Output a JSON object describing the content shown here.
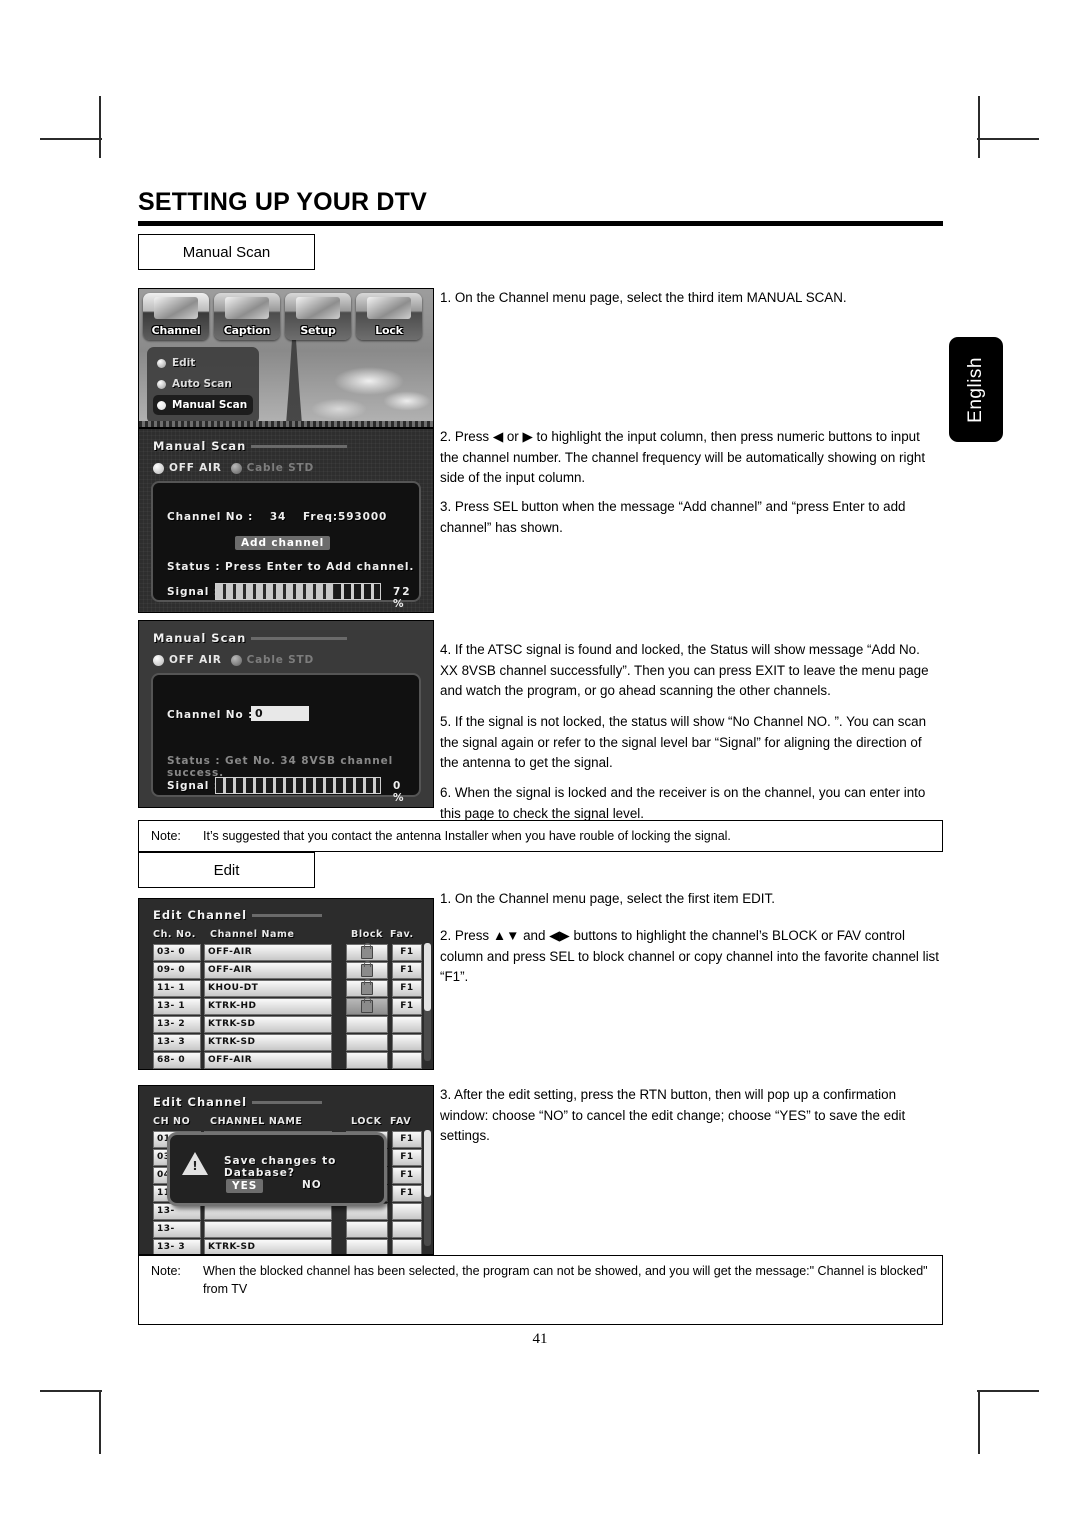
{
  "page": {
    "title": "SETTING UP YOUR DTV",
    "number": "41",
    "side_tab": "English"
  },
  "sections": [
    {
      "label": "Manual Scan"
    },
    {
      "label": "Edit"
    }
  ],
  "labels": {
    "manual_scan": "Manual Scan",
    "edit": "Edit"
  },
  "manual_scan_steps": {
    "s1": "1. On the Channel menu page, select the third item MANUAL SCAN.",
    "s2": "2. Press ◀ or ▶ to highlight the input column, then press numeric buttons to input the channel number. The channel frequency will be automatically showing on right side of the input column.",
    "s3": "3. Press SEL button when the message “Add channel” and “press Enter to add channel” has shown.",
    "s4": "4. If the ATSC signal is found and locked, the Status will show message “Add No. XX 8VSB channel successfully”. Then you can press EXIT to leave the menu page and watch the program, or go ahead scanning the other channels.",
    "s5": "5. If the signal is not locked, the status will show “No Channel NO. ”. You can scan the signal again or refer to the signal level bar “Signal” for aligning the direction of the antenna to get the signal.",
    "s6": "6. When the signal is locked and the receiver is on the channel, you can enter into this page to check the signal level."
  },
  "edit_steps": {
    "s1": "1. On the Channel menu page, select the first item EDIT.",
    "s2": "2. Press ▲▼ and ◀▶ buttons to highlight the channel’s BLOCK or FAV control column and press SEL to block channel or copy channel into the favorite channel list “F1”.",
    "s3": "3. After the edit setting, press the RTN button, then will pop up a confirmation window: choose “NO” to cancel the edit change; choose “YES” to save the edit settings."
  },
  "notes": {
    "note1_label": "Note:",
    "note1_text": "It’s suggested that you contact the antenna Installer when you have rouble of locking the signal.",
    "note2_label": "Note:",
    "note2_text": "When the blocked channel has been selected, the program can not be showed, and you will get the message:\" Channel is blocked\" from TV"
  },
  "osd_menu": {
    "tabs": [
      {
        "label": "Channel",
        "icon": "remote-icon",
        "selected": true
      },
      {
        "label": "Caption",
        "icon": "screen-icon",
        "selected": false
      },
      {
        "label": "Setup",
        "icon": "tools-icon",
        "selected": false
      },
      {
        "label": "Lock",
        "icon": "padlock-icon",
        "selected": false
      }
    ],
    "items": [
      {
        "label": "Edit",
        "active": false
      },
      {
        "label": "Auto  Scan",
        "active": false
      },
      {
        "label": "Manual  Scan",
        "active": true
      }
    ]
  },
  "osd_manual_scan_1": {
    "title": "Manual Scan",
    "source_off_air": "OFF AIR",
    "source_cable": "Cable  STD",
    "channel_label": "Channel No :",
    "channel_value": "34",
    "freq_label": "Freq:593000",
    "add_button": "Add channel",
    "status_label": "Status : Press Enter to Add channel.",
    "signal_label": "Signal :",
    "signal_percent": "72 %",
    "signal_value": 72
  },
  "osd_manual_scan_2": {
    "title": "Manual Scan",
    "source_off_air": "OFF AIR",
    "source_cable": "Cable  STD",
    "channel_label": "Channel No :",
    "channel_value": "0",
    "status_label": "Status : Get No. 34   8VSB channel success.",
    "signal_label": "Signal :",
    "signal_percent": "0  %",
    "signal_value": 0
  },
  "osd_edit_channel": {
    "title": "Edit Channel",
    "headers": {
      "no": "Ch. No.",
      "name": "Channel Name",
      "block": "Block",
      "fav": "Fav."
    },
    "rows": [
      {
        "no": "03- 0",
        "name": "OFF-AIR",
        "block": true,
        "fav": "F1"
      },
      {
        "no": "09- 0",
        "name": "OFF-AIR",
        "block": true,
        "fav": "F1"
      },
      {
        "no": "11- 1",
        "name": "KHOU-DT",
        "block": true,
        "fav": "F1"
      },
      {
        "no": "13- 1",
        "name": "KTRK-HD",
        "block": true,
        "fav": "F1"
      },
      {
        "no": "13- 2",
        "name": "KTRK-SD",
        "block": false,
        "fav": ""
      },
      {
        "no": "13- 3",
        "name": "KTRK-SD",
        "block": false,
        "fav": ""
      },
      {
        "no": "68- 0",
        "name": "OFF-AIR",
        "block": false,
        "fav": ""
      },
      {
        "no": "",
        "name": "",
        "block": false,
        "fav": ""
      },
      {
        "no": "",
        "name": "",
        "block": false,
        "fav": ""
      }
    ]
  },
  "osd_edit_confirm": {
    "title": "Edit Channel",
    "headers": {
      "no": "CH NO",
      "name": "CHANNEL NAME",
      "block": "LOCK",
      "fav": "FAV"
    },
    "rows": [
      {
        "no": "01-",
        "name": "",
        "fav": "F1"
      },
      {
        "no": "03-",
        "name": "",
        "fav": "F1"
      },
      {
        "no": "04-",
        "name": "",
        "fav": "F1"
      },
      {
        "no": "11-",
        "name": "",
        "fav": "F1"
      },
      {
        "no": "13-",
        "name": "",
        "fav": ""
      },
      {
        "no": "13-",
        "name": "",
        "fav": ""
      },
      {
        "no": "13- 3",
        "name": "KTRK-SD",
        "fav": ""
      },
      {
        "no": "",
        "name": "",
        "fav": ""
      },
      {
        "no": "",
        "name": "",
        "fav": ""
      }
    ],
    "dialog": {
      "message": "Save changes to Database?",
      "yes": "YES",
      "no": "NO",
      "icon": "warning-icon"
    }
  }
}
